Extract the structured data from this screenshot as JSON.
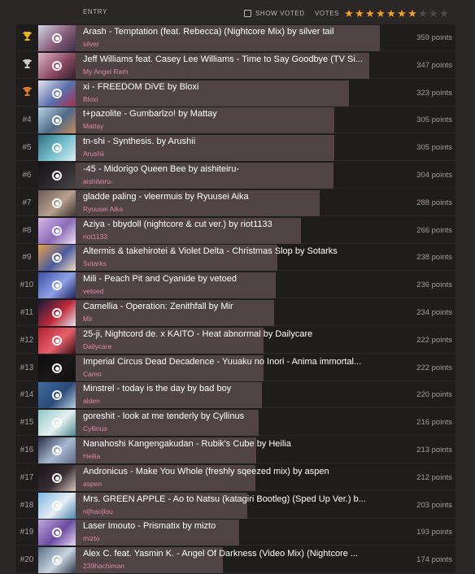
{
  "header": {
    "entry_label": "ENTRY",
    "show_voted_label": "SHOW VOTED",
    "votes_label": "VOTES",
    "votes_filled": 7,
    "votes_total": 10,
    "star_on_color": "#f3a21f",
    "star_off_color": "#4f4848"
  },
  "entries": [
    {
      "rank": "1",
      "trophy": "gold",
      "title": "Arash - Temptation (feat. Rebecca) (Nightcore Mix) by silver tail",
      "artist": "silver",
      "points": "359 points",
      "score": 359,
      "thumb": [
        "#cfd6e6",
        "#8a5e7a",
        "#3b2f4a"
      ]
    },
    {
      "rank": "2",
      "trophy": "silver",
      "title": "Jeff Williams feat. Casey Lee Williams - Time to Say Goodbye (TV Si...",
      "artist": "My Angel Ram",
      "points": "347 points",
      "score": 347,
      "thumb": [
        "#d9b7c4",
        "#8e4a62",
        "#2e1f2a"
      ]
    },
    {
      "rank": "3",
      "trophy": "bronze",
      "title": "xi - FREEDOM DiVE by Bloxi",
      "artist": "Bloxi",
      "points": "323 points",
      "score": 323,
      "thumb": [
        "#e8e4ec",
        "#5a6fae",
        "#a8304a"
      ]
    },
    {
      "rank": "#4",
      "trophy": "",
      "title": "t+pazolite - Gumbarlzo! by Mattay",
      "artist": "Mattay",
      "points": "305 points",
      "score": 305,
      "thumb": [
        "#b8d2e6",
        "#4f6a86",
        "#c78a5a"
      ]
    },
    {
      "rank": "#5",
      "trophy": "",
      "title": "tn-shi - Synthesis. by Arushii",
      "artist": "Arushii",
      "points": "305 points",
      "score": 305,
      "thumb": [
        "#2f6f86",
        "#78c2cf",
        "#e0eef2"
      ]
    },
    {
      "rank": "#6",
      "trophy": "",
      "title": "-45 - Midorigo Queen Bee by aishiteiru-",
      "artist": "aishiteiru-",
      "points": "304 points",
      "score": 304,
      "thumb": [
        "#141214",
        "#2e2a2e",
        "#4a4448"
      ]
    },
    {
      "rank": "#7",
      "trophy": "",
      "title": "gladde paling - vleermuis by Ryuusei Aika",
      "artist": "Ryuusei Aika",
      "points": "288 points",
      "score": 288,
      "thumb": [
        "#6a5b56",
        "#b8a090",
        "#3e3431"
      ]
    },
    {
      "rank": "#8",
      "trophy": "",
      "title": "Aziya - bbydoll (nightcore & cut ver.) by riot1133",
      "artist": "riot1133",
      "points": "266 points",
      "score": 266,
      "thumb": [
        "#d5b6e6",
        "#8a6cb8",
        "#f0e2f4"
      ]
    },
    {
      "rank": "#9",
      "trophy": "",
      "title": "Altermis & takehirotei & Violet Delta - Christmas Slop by Sotarks",
      "artist": "Sotarks",
      "points": "238 points",
      "score": 238,
      "thumb": [
        "#e6a24a",
        "#4a5a9e",
        "#f2e0c0"
      ]
    },
    {
      "rank": "#10",
      "trophy": "",
      "title": "Mili - Peach Pit and Cyanide by vetoed",
      "artist": "vetoed",
      "points": "236 points",
      "score": 236,
      "thumb": [
        "#3a4ea8",
        "#8fa2e6",
        "#1e2260"
      ]
    },
    {
      "rank": "#11",
      "trophy": "",
      "title": "Camellia - Operation: Zenithfall by Mir",
      "artist": "Mir",
      "points": "234 points",
      "score": 234,
      "thumb": [
        "#151a3a",
        "#c02a3a",
        "#e6e6f0"
      ]
    },
    {
      "rank": "#12",
      "trophy": "",
      "title": "25-ji, Nightcord de. x KAITO - Heat abnormal by Dailycare",
      "artist": "Dailycare",
      "points": "222 points",
      "score": 222,
      "thumb": [
        "#b0202e",
        "#e6606a",
        "#3a1016"
      ]
    },
    {
      "rank": "#13",
      "trophy": "",
      "title": "Imperial Circus Dead Decadence - Yuuaku no Inori - Anima immortal...",
      "artist": "Camo",
      "points": "222 points",
      "score": 222,
      "thumb": [
        "#0c0c0c",
        "#1a1818",
        "#101010"
      ]
    },
    {
      "rank": "#14",
      "trophy": "",
      "title": "Minstrel - today is the day by bad boy",
      "artist": "alden",
      "points": "220 points",
      "score": 220,
      "thumb": [
        "#3e6ea0",
        "#2a4a78",
        "#b8cce0"
      ]
    },
    {
      "rank": "#15",
      "trophy": "",
      "title": "goreshit - look at me tenderly by Cyllinus",
      "artist": "Cyllinus",
      "points": "216 points",
      "score": 216,
      "thumb": [
        "#8ec8c8",
        "#e6f0f0",
        "#4a8a90"
      ]
    },
    {
      "rank": "#16",
      "trophy": "",
      "title": "Nanahoshi Kangengakudan - Rubik's Cube by Heilia",
      "artist": "Heilia",
      "points": "213 points",
      "score": 213,
      "thumb": [
        "#2a3048",
        "#a8b8d0",
        "#606a86"
      ]
    },
    {
      "rank": "#17",
      "trophy": "",
      "title": "Andronicus - Make You Whole (freshly sqeezed mix) by aspen",
      "artist": "aspen",
      "points": "212 points",
      "score": 212,
      "thumb": [
        "#1a1418",
        "#3a2e34",
        "#d8c8c0"
      ]
    },
    {
      "rank": "#18",
      "trophy": "",
      "title": "Mrs. GREEN APPLE - Ao to Natsu (katagiri Bootleg) (Sped Up Ver.) b...",
      "artist": "ni[hao]lou",
      "points": "203 points",
      "score": 203,
      "thumb": [
        "#7ab8e6",
        "#e6eef4",
        "#4a86b0"
      ]
    },
    {
      "rank": "#19",
      "trophy": "",
      "title": "Laser Imouto - Prismatix by mizto",
      "artist": "mizto",
      "points": "193 points",
      "score": 193,
      "thumb": [
        "#c0a8e0",
        "#6a4aa0",
        "#e8d8f4"
      ]
    },
    {
      "rank": "#20",
      "trophy": "",
      "title": "Alex C. feat. Yasmin K. - Angel Of Darkness (Video Mix) (Nightcore ...",
      "artist": "239hachiman",
      "points": "174 points",
      "score": 174,
      "thumb": [
        "#5a7088",
        "#c8d4e0",
        "#30384a"
      ]
    }
  ],
  "colors": {
    "bar": "#4f4344",
    "artist": "#e08aa9",
    "gold": "#e8b21c",
    "silver": "#c8c8c8",
    "bronze": "#d8782a"
  }
}
